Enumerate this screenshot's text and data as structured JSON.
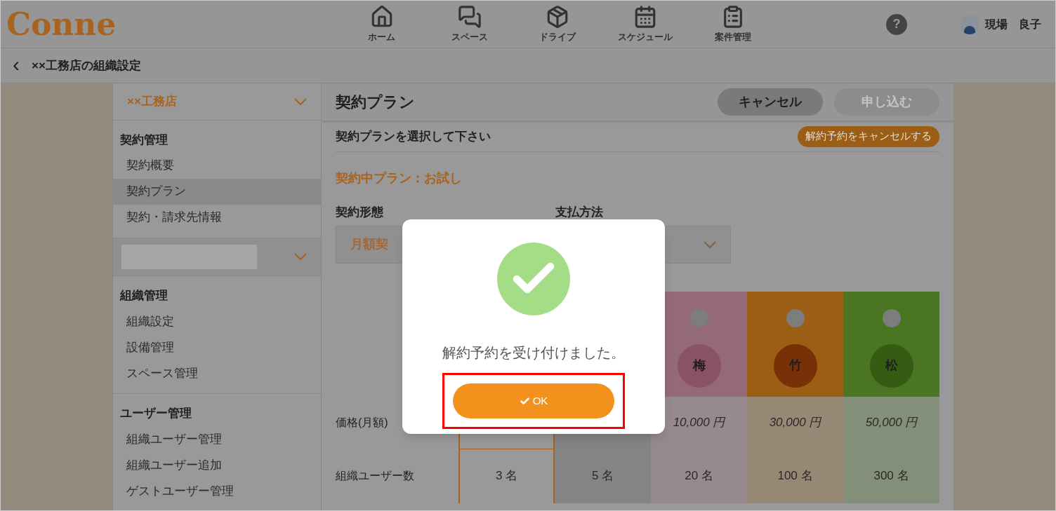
{
  "header": {
    "logo": "Conne",
    "nav": [
      {
        "label": "ホーム"
      },
      {
        "label": "スペース"
      },
      {
        "label": "ドライブ"
      },
      {
        "label": "スケジュール"
      },
      {
        "label": "案件管理"
      }
    ],
    "help": "?",
    "user": "現場　良子"
  },
  "breadcrumb": {
    "back": "‹",
    "title": "××工務店の組織設定"
  },
  "sidebar": {
    "organization": "××工務店",
    "sections": [
      {
        "kind": "section",
        "title": "契約管理",
        "items": [
          {
            "label": "契約概要",
            "selected": false
          },
          {
            "label": "契約プラン",
            "selected": true
          },
          {
            "label": "契約・請求先情報",
            "selected": false
          }
        ]
      },
      {
        "kind": "redacted"
      },
      {
        "kind": "section",
        "title": "組織管理",
        "items": [
          {
            "label": "組織設定",
            "selected": false
          },
          {
            "label": "設備管理",
            "selected": false
          },
          {
            "label": "スペース管理",
            "selected": false
          }
        ]
      },
      {
        "kind": "section",
        "title": "ユーザー管理",
        "items": [
          {
            "label": "組織ユーザー管理",
            "selected": false
          },
          {
            "label": "組織ユーザー追加",
            "selected": false
          },
          {
            "label": "ゲストユーザー管理",
            "selected": false
          }
        ]
      }
    ]
  },
  "main": {
    "title": "契約プラン",
    "buttons": [
      {
        "label": "キャンセル",
        "disabled": false
      },
      {
        "label": "申し込む",
        "disabled": true
      }
    ],
    "instruction": "契約プランを選択して下さい",
    "cancel_reservation": "解約予約をキャンセルする",
    "current_plan": "契約中プラン：お試し",
    "contract_type": {
      "label": "契約形態",
      "value": "月額契"
    },
    "payment_method": {
      "label": "支払方法"
    },
    "row_labels": [
      "価格(月額)",
      "組織ユーザー数"
    ],
    "plans": [
      {
        "kind": "plain",
        "selected": true,
        "current": false,
        "users": "3 名"
      },
      {
        "kind": "plain",
        "selected": false,
        "current": true,
        "users": "5 名"
      },
      {
        "kind": "emblem",
        "selected": false,
        "color": "#946a78",
        "emblem": "梅",
        "price": "10,000 円",
        "users": "20 名"
      },
      {
        "kind": "emblem",
        "selected": false,
        "color": "#9c5e14",
        "emblem": "竹",
        "price": "30,000 円",
        "users": "100 名"
      },
      {
        "kind": "emblem",
        "selected": false,
        "color": "#4a7522",
        "emblem": "松",
        "price": "50,000 円",
        "users": "300 名"
      }
    ]
  },
  "dialog": {
    "message": "解約予約を受け付けました。",
    "ok": "OK",
    "highlighted": true
  }
}
